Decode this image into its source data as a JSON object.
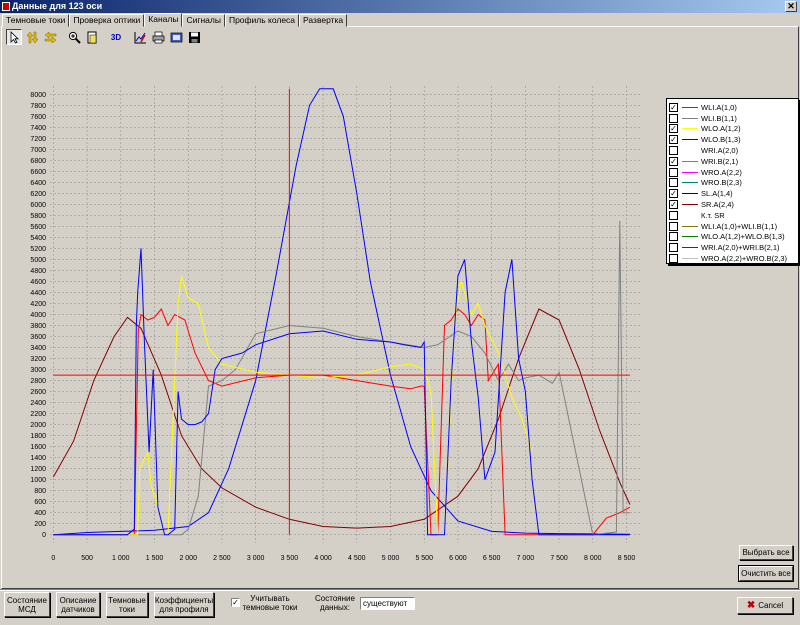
{
  "window": {
    "title": "Данные для 123 оси",
    "close_glyph": "✕"
  },
  "tabs": [
    "Темновые токи",
    "Проверка оптики",
    "Каналы",
    "Сигналы",
    "Профиль колеса",
    "Развертка"
  ],
  "active_tab": 2,
  "toolbar": {
    "icons": [
      "pointer-icon",
      "swap-vertical-icon",
      "swap-horizontal-icon",
      "zoom-icon",
      "page-icon",
      "3d-icon",
      "chart-settings-icon",
      "print-icon",
      "export-icon",
      "save-icon"
    ],
    "label_3d": "3D"
  },
  "legend": [
    {
      "label": "WLI.A(1,0)",
      "checked": true,
      "color": "#ff0000"
    },
    {
      "label": "WLI.B(1,1)",
      "checked": false,
      "color": "#808080"
    },
    {
      "label": "WLO.A(1,2)",
      "checked": true,
      "color": "#ffff00"
    },
    {
      "label": "WLO.B(1,3)",
      "checked": true,
      "color": "#0000ff"
    },
    {
      "label": "WRI.A(2,0)",
      "checked": false,
      "color": "#ffffff"
    },
    {
      "label": "WRI.B(2,1)",
      "checked": true,
      "color": "#808080"
    },
    {
      "label": "WRO.A(2,2)",
      "checked": false,
      "color": "#ff00ff"
    },
    {
      "label": "WRO.B(2,3)",
      "checked": false,
      "color": "#008080"
    },
    {
      "label": "SL.A(1,4)",
      "checked": true,
      "color": "#000080"
    },
    {
      "label": "SR.A(2,4)",
      "checked": true,
      "color": "#800000"
    },
    {
      "label": "К.т. SR",
      "checked": false,
      "color": "#ffffff"
    },
    {
      "label": "WLI.A(1,0)+WLI.B(1,1)",
      "checked": false,
      "color": "#808000"
    },
    {
      "label": "WLO.A(1,2)+WLO.B(1,3)",
      "checked": false,
      "color": "#008000"
    },
    {
      "label": "WRI.A(2,0)+WRI.B(2,1)",
      "checked": false,
      "color": "#800080"
    },
    {
      "label": "WRO.A(2,2)+WRO.B(2,3)",
      "checked": false,
      "color": "#c0c0c0"
    }
  ],
  "buttons": {
    "select_all": "Выбрать все",
    "clear_all": "Очистить все",
    "msd_state_1": "Состояние",
    "msd_state_2": "МСД",
    "sensor_desc_1": "Описание",
    "sensor_desc_2": "датчиков",
    "dark_currents_1": "Темновые",
    "dark_currents_2": "токи",
    "profile_coef_1": "Коэффициенты",
    "profile_coef_2": "для профиля",
    "cancel": "Cancel",
    "cancel_icon": "✖"
  },
  "options": {
    "dark_checkbox_label_1": "Учитывать",
    "dark_checkbox_label_2": "темновые токи",
    "dark_checked": true,
    "data_state_label_1": "Состояние",
    "data_state_label_2": "данных:",
    "data_state_value": "существуют"
  },
  "chart_data": {
    "type": "line",
    "grid": true,
    "xlim": [
      -50,
      8700
    ],
    "ylim": [
      -150,
      8150
    ],
    "x_ticks": [
      0,
      500,
      1000,
      1500,
      2000,
      2500,
      3000,
      3500,
      4000,
      4500,
      5000,
      5500,
      6000,
      6500,
      7000,
      7500,
      8000,
      8500
    ],
    "x_tick_labels": [
      "0",
      "500",
      "1 000",
      "1 500",
      "2 000",
      "2 500",
      "3 000",
      "3 500",
      "4 000",
      "4 500",
      "5 000",
      "5 500",
      "6 000",
      "6 500",
      "7 000",
      "7 500",
      "8 000",
      "8 500"
    ],
    "y_ticks": [
      0,
      200,
      400,
      600,
      800,
      1000,
      1200,
      1400,
      1600,
      1800,
      2000,
      2200,
      2400,
      2600,
      2800,
      3000,
      3200,
      3400,
      3600,
      3800,
      4000,
      4200,
      4400,
      4600,
      4800,
      5000,
      5200,
      5400,
      5600,
      5800,
      6000,
      6200,
      6400,
      6600,
      6800,
      7000,
      7200,
      7400,
      7600,
      7800,
      8000
    ],
    "reference_lines": [
      {
        "orientation": "horizontal",
        "value": 2900,
        "x_range": [
          0,
          8550
        ],
        "color": "#ff0000"
      },
      {
        "orientation": "vertical",
        "value": 3500,
        "y_range": [
          0,
          8100
        ],
        "color": "#ff0000"
      }
    ],
    "series": [
      {
        "key": "sr_a",
        "color": "#800000",
        "x": [
          0,
          300,
          600,
          900,
          1100,
          1300,
          1600,
          1900,
          2200,
          2500,
          3000,
          3500,
          4000,
          4500,
          5000,
          5500,
          6000,
          6300,
          6600,
          6900,
          7200,
          7500,
          7800,
          8100,
          8400,
          8550
        ],
        "y": [
          1050,
          1700,
          2800,
          3600,
          3950,
          3750,
          2900,
          1800,
          1200,
          850,
          500,
          280,
          150,
          120,
          150,
          280,
          700,
          1200,
          2100,
          3200,
          4100,
          3900,
          3000,
          1900,
          950,
          550
        ]
      },
      {
        "key": "sl_a",
        "color": "#0000ff",
        "x": [
          0,
          500,
          1000,
          1500,
          2000,
          2300,
          2600,
          3000,
          3300,
          3600,
          3800,
          3950,
          4150,
          4300,
          4500,
          4700,
          5000,
          5300,
          5600,
          6000,
          6500,
          7000,
          7500,
          8000,
          8550
        ],
        "y": [
          0,
          40,
          60,
          80,
          150,
          400,
          1200,
          2800,
          4700,
          6700,
          7800,
          8100,
          8100,
          7600,
          6200,
          4600,
          2900,
          1600,
          800,
          250,
          60,
          30,
          20,
          15,
          10
        ]
      },
      {
        "key": "wli_a",
        "color": "#ff0000",
        "x": [
          0,
          1100,
          1200,
          1260,
          1300,
          1400,
          1500,
          1600,
          1700,
          1800,
          1950,
          2100,
          2300,
          2500,
          3000,
          3500,
          4000,
          4500,
          5000,
          5300,
          5450,
          5500,
          5600,
          5700,
          5800,
          5900,
          6000,
          6100,
          6200,
          6300,
          6400,
          6450,
          6600,
          6700,
          6800,
          6900,
          7000,
          8000,
          8200,
          8400,
          8550
        ],
        "y": [
          0,
          0,
          0,
          3700,
          4000,
          3900,
          3950,
          4100,
          3800,
          4000,
          3900,
          3300,
          2800,
          2700,
          2850,
          2900,
          2900,
          2800,
          2700,
          2650,
          2700,
          2700,
          0,
          0,
          3800,
          3900,
          4100,
          4000,
          3800,
          4000,
          3900,
          2800,
          3100,
          0,
          0,
          0,
          0,
          0,
          300,
          400,
          500
        ]
      },
      {
        "key": "wri_b",
        "color": "#808080",
        "x": [
          0,
          1900,
          2000,
          2150,
          2300,
          2500,
          2700,
          3000,
          3500,
          4000,
          4500,
          5000,
          5500,
          5700,
          6000,
          6200,
          6400,
          6600,
          6750,
          6900,
          7000,
          7200,
          7400,
          7500,
          8000,
          8350,
          8400,
          8450,
          8550
        ],
        "y": [
          0,
          0,
          100,
          700,
          2700,
          2800,
          3000,
          3650,
          3800,
          3750,
          3600,
          3500,
          3400,
          3450,
          3700,
          3600,
          3300,
          2800,
          3100,
          2800,
          2850,
          2900,
          2750,
          2950,
          0,
          50,
          5700,
          400,
          400
        ]
      },
      {
        "key": "wlo_a",
        "color": "#ffff00",
        "x": [
          1100,
          1250,
          1280,
          1400,
          1450,
          1550,
          1650,
          1700,
          1850,
          1900,
          2000,
          2150,
          2300,
          2500,
          3000,
          3500,
          4000,
          4500,
          5000,
          5300,
          5500,
          5600,
          5700,
          5800,
          5950,
          6050,
          6200,
          6300,
          6400,
          6600,
          6800,
          6950,
          7050,
          7100
        ],
        "y": [
          0,
          0,
          1200,
          1500,
          900,
          500,
          0,
          0,
          4200,
          4700,
          4300,
          4200,
          3400,
          3100,
          2950,
          2900,
          2850,
          2900,
          3050,
          3100,
          3000,
          2600,
          0,
          0,
          3900,
          4600,
          4000,
          4200,
          3800,
          3300,
          2500,
          2100,
          1700,
          1500
        ]
      },
      {
        "key": "wlo_b",
        "color": "#0000ff",
        "x": [
          0,
          1100,
          1200,
          1230,
          1250,
          1300,
          1350,
          1420,
          1480,
          1550,
          1650,
          1700,
          1800,
          1850,
          1900,
          2000,
          2100,
          2200,
          2300,
          2400,
          2500,
          2800,
          3000,
          3500,
          4000,
          4500,
          5000,
          5200,
          5450,
          5500,
          5550,
          5700,
          5800,
          5900,
          6000,
          6100,
          6200,
          6300,
          6400,
          6550,
          6700,
          6800,
          6900,
          7000,
          7100,
          7200,
          8000,
          8550
        ],
        "y": [
          0,
          0,
          100,
          3800,
          4400,
          5200,
          3500,
          1500,
          3000,
          500,
          0,
          0,
          100,
          2600,
          2100,
          2000,
          2000,
          2050,
          2200,
          3000,
          3200,
          3300,
          3450,
          3650,
          3700,
          3550,
          3500,
          3450,
          3400,
          3500,
          0,
          0,
          0,
          2800,
          4700,
          5000,
          3500,
          2500,
          1000,
          1500,
          4400,
          5000,
          3200,
          2600,
          1000,
          0,
          0,
          0
        ]
      }
    ]
  }
}
